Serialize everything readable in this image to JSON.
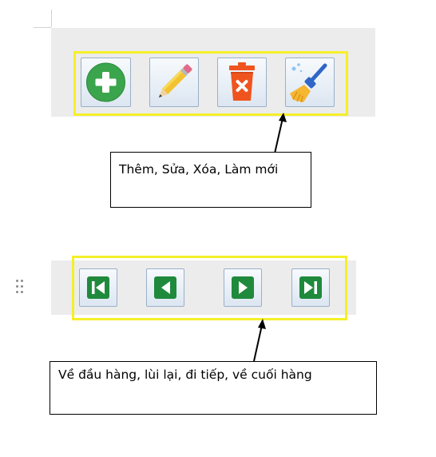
{
  "toolbar_crud": {
    "buttons": [
      {
        "name": "add-button",
        "icon": "plus-circle-icon",
        "color": "#3aa54c"
      },
      {
        "name": "edit-button",
        "icon": "pencil-icon",
        "color": "#f2c230"
      },
      {
        "name": "delete-button",
        "icon": "trash-delete-icon",
        "color": "#f0541e"
      },
      {
        "name": "refresh-button",
        "icon": "broom-icon",
        "color": "#2f66c7"
      }
    ]
  },
  "callout_crud": {
    "text": "Thêm, Sửa, Xóa, Làm mới"
  },
  "toolbar_nav": {
    "buttons": [
      {
        "name": "first-record-button",
        "icon": "skip-first-icon",
        "color": "#1f8a3c"
      },
      {
        "name": "previous-button",
        "icon": "previous-icon",
        "color": "#1f8a3c"
      },
      {
        "name": "next-button",
        "icon": "next-icon",
        "color": "#1f8a3c"
      },
      {
        "name": "last-record-button",
        "icon": "skip-last-icon",
        "color": "#1f8a3c"
      }
    ]
  },
  "callout_nav": {
    "text": "Về đầu hàng, lùi lại, đi tiếp, về cuối hàng"
  },
  "colors": {
    "highlight": "#f5ef2a",
    "toolbar_bg": "#ececec"
  }
}
